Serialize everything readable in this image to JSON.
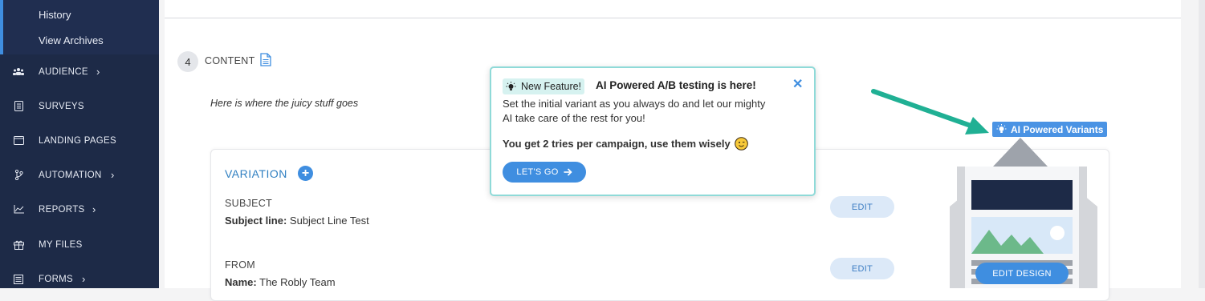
{
  "sidebar": {
    "sub_items": [
      "History",
      "View Archives"
    ],
    "items": [
      {
        "label": "AUDIENCE",
        "icon": "people-icon",
        "has_chevron": true
      },
      {
        "label": "SURVEYS",
        "icon": "survey-icon",
        "has_chevron": false
      },
      {
        "label": "LANDING PAGES",
        "icon": "browser-icon",
        "has_chevron": false
      },
      {
        "label": "AUTOMATION",
        "icon": "branch-icon",
        "has_chevron": true
      },
      {
        "label": "REPORTS",
        "icon": "chart-icon",
        "has_chevron": true
      },
      {
        "label": "MY FILES",
        "icon": "gift-box-icon",
        "has_chevron": false
      },
      {
        "label": "FORMS",
        "icon": "form-icon",
        "has_chevron": true
      }
    ]
  },
  "content": {
    "step_number": "4",
    "section_label": "CONTENT",
    "description": "Here is where the juicy stuff goes",
    "variation_label": "VARIATION",
    "subject_label": "SUBJECT",
    "subject_line_key": "Subject line:",
    "subject_line_value": "Subject Line Test",
    "from_label": "FROM",
    "name_key": "Name:",
    "name_value": "The Robly Team",
    "edit_label": "EDIT",
    "edit_design_label": "EDIT DESIGN"
  },
  "popup": {
    "badge": "New Feature!",
    "title": "AI Powered A/B testing is here!",
    "description": "Set the initial variant as you always do and let our mighty AI take care of the rest for you!",
    "tries": "You get 2 tries per campaign, use them wisely",
    "cta": "LET'S GO",
    "close_symbol": "✕"
  },
  "ai_variants_label": "AI Powered Variants",
  "colors": {
    "sidebar_bg": "#1d2a47",
    "accent": "#3f8ee0",
    "popup_border": "#8fdad8",
    "arrow": "#20b094"
  }
}
